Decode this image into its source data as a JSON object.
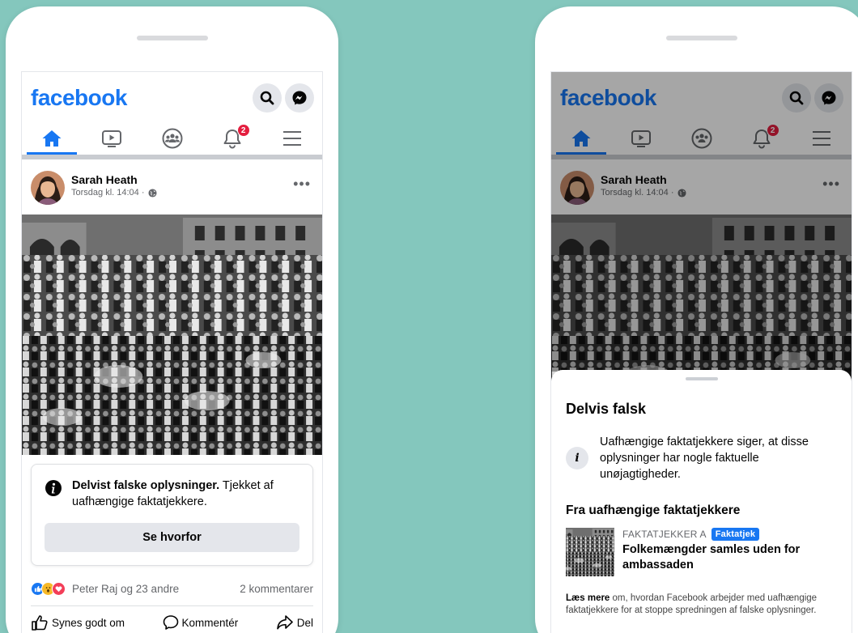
{
  "app": {
    "logo": "facebook"
  },
  "colors": {
    "brand": "#1877f2",
    "background": "#84c7bd",
    "badge": "#e41e3f"
  },
  "header": {
    "icons": [
      "search-icon",
      "messenger-icon"
    ],
    "nav": [
      {
        "icon": "home-icon",
        "active": true
      },
      {
        "icon": "watch-icon",
        "active": false
      },
      {
        "icon": "groups-icon",
        "active": false
      },
      {
        "icon": "bell-icon",
        "active": false,
        "badge": "2"
      },
      {
        "icon": "menu-icon",
        "active": false
      }
    ]
  },
  "post": {
    "author": "Sarah Heath",
    "timestamp": "Torsdag kl. 14:04 ·",
    "privacy_icon": "globe-icon",
    "warning_bold": "Delvist falske oplysninger.",
    "warning_rest": " Tjekket af uafhængige faktatjekkere.",
    "see_why": "Se hvorfor",
    "reactions_text": "Peter Raj og 23 andre",
    "comments_count": "2 kommentarer",
    "actions": {
      "like": "Synes godt om",
      "comment": "Kommentér",
      "share": "Del"
    }
  },
  "sheet": {
    "title": "Delvis falsk",
    "info": "Uafhængige faktatjekkere siger, at disse oplysninger har nogle faktuelle unøjagtigheder.",
    "section_title": "Fra uafhængige faktatjekkere",
    "source": "FAKTATJEKKER A",
    "tag": "Faktatjek",
    "headline": "Folkemængder samles uden for ambassaden",
    "learn_bold": "Læs mere",
    "learn_rest": " om, hvordan Facebook arbejder med uafhængige faktatjekkere for at stoppe spredningen af falske oplysninger."
  }
}
